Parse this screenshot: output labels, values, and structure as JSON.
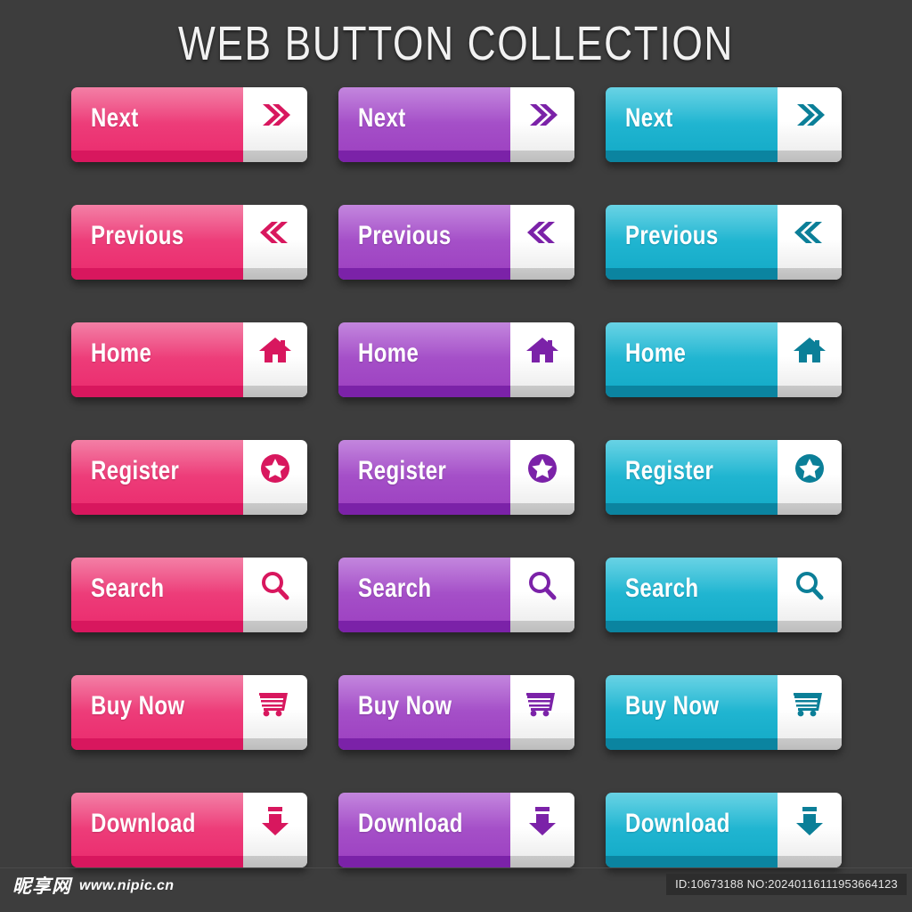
{
  "header": {
    "title": "WEB BUTTON COLLECTION"
  },
  "colors": {
    "background": "#3d3d3d",
    "pink": "#ed3b78",
    "pink_dark": "#d8175e",
    "purple": "#a44ec7",
    "purple_dark": "#7b22a8",
    "teal": "#1fb4d0",
    "teal_dark": "#0b84a0",
    "icon_pane": "#ffffff",
    "title_text": "#f2f2f2"
  },
  "buttons": {
    "rows": [
      {
        "action": "next",
        "icon": "chevron-double-right-icon",
        "variants": [
          {
            "label": "Next",
            "color": "pink",
            "icon_color": "#d8175e"
          },
          {
            "label": "Next",
            "color": "purple",
            "icon_color": "#7b22a8"
          },
          {
            "label": "Next",
            "color": "teal",
            "icon_color": "#0b7f98"
          }
        ]
      },
      {
        "action": "previous",
        "icon": "chevron-double-left-icon",
        "variants": [
          {
            "label": "Previous",
            "color": "pink",
            "icon_color": "#d8175e"
          },
          {
            "label": "Previous",
            "color": "purple",
            "icon_color": "#7b22a8"
          },
          {
            "label": "Previous",
            "color": "teal",
            "icon_color": "#0b7f98"
          }
        ]
      },
      {
        "action": "home",
        "icon": "house-icon",
        "variants": [
          {
            "label": "Home",
            "color": "pink",
            "icon_color": "#d8175e"
          },
          {
            "label": "Home",
            "color": "purple",
            "icon_color": "#7b22a8"
          },
          {
            "label": "Home",
            "color": "teal",
            "icon_color": "#0b7f98"
          }
        ]
      },
      {
        "action": "register",
        "icon": "star-circle-icon",
        "variants": [
          {
            "label": "Register",
            "color": "pink",
            "icon_color": "#d8175e"
          },
          {
            "label": "Register",
            "color": "purple",
            "icon_color": "#7b22a8"
          },
          {
            "label": "Register",
            "color": "teal",
            "icon_color": "#0b7f98"
          }
        ]
      },
      {
        "action": "search",
        "icon": "magnifier-icon",
        "variants": [
          {
            "label": "Search",
            "color": "pink",
            "icon_color": "#d8175e"
          },
          {
            "label": "Search",
            "color": "purple",
            "icon_color": "#7b22a8"
          },
          {
            "label": "Search",
            "color": "teal",
            "icon_color": "#0b7f98"
          }
        ]
      },
      {
        "action": "buy-now",
        "icon": "shopping-cart-icon",
        "variants": [
          {
            "label": "Buy Now",
            "color": "pink",
            "icon_color": "#d8175e"
          },
          {
            "label": "Buy Now",
            "color": "purple",
            "icon_color": "#7b22a8"
          },
          {
            "label": "Buy Now",
            "color": "teal",
            "icon_color": "#0b7f98"
          }
        ]
      },
      {
        "action": "download",
        "icon": "download-arrow-icon",
        "variants": [
          {
            "label": "Download",
            "color": "pink",
            "icon_color": "#d8175e"
          },
          {
            "label": "Download",
            "color": "purple",
            "icon_color": "#7b22a8"
          },
          {
            "label": "Download",
            "color": "teal",
            "icon_color": "#0b7f98"
          }
        ]
      }
    ]
  },
  "footer": {
    "brand_mark": "昵享网",
    "brand_url": "www.nipic.cn",
    "id_text": "ID:10673188 NO:20240116111953664123"
  }
}
